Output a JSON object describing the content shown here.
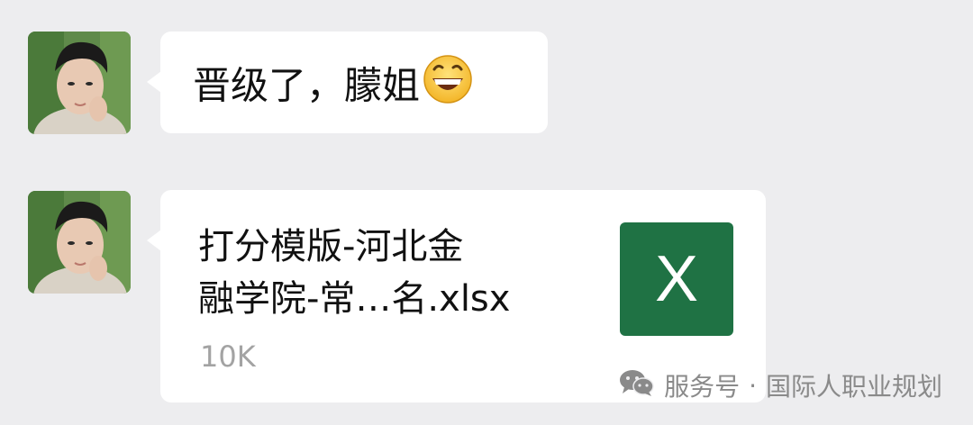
{
  "messages": [
    {
      "sender_avatar": "avatar-photo",
      "text": "晋级了，朦姐",
      "emoji": "grinning-face-emoji"
    },
    {
      "sender_avatar": "avatar-photo",
      "file": {
        "name_line1": "打分模版-河北金",
        "name_line2": "融学院-常…名.xlsx",
        "size": "10K",
        "icon_letter": "X",
        "icon_color": "#1f7244"
      }
    }
  ],
  "watermark": {
    "icon": "wechat-icon",
    "label": "服务号",
    "separator": "·",
    "account": "国际人职业规划"
  }
}
